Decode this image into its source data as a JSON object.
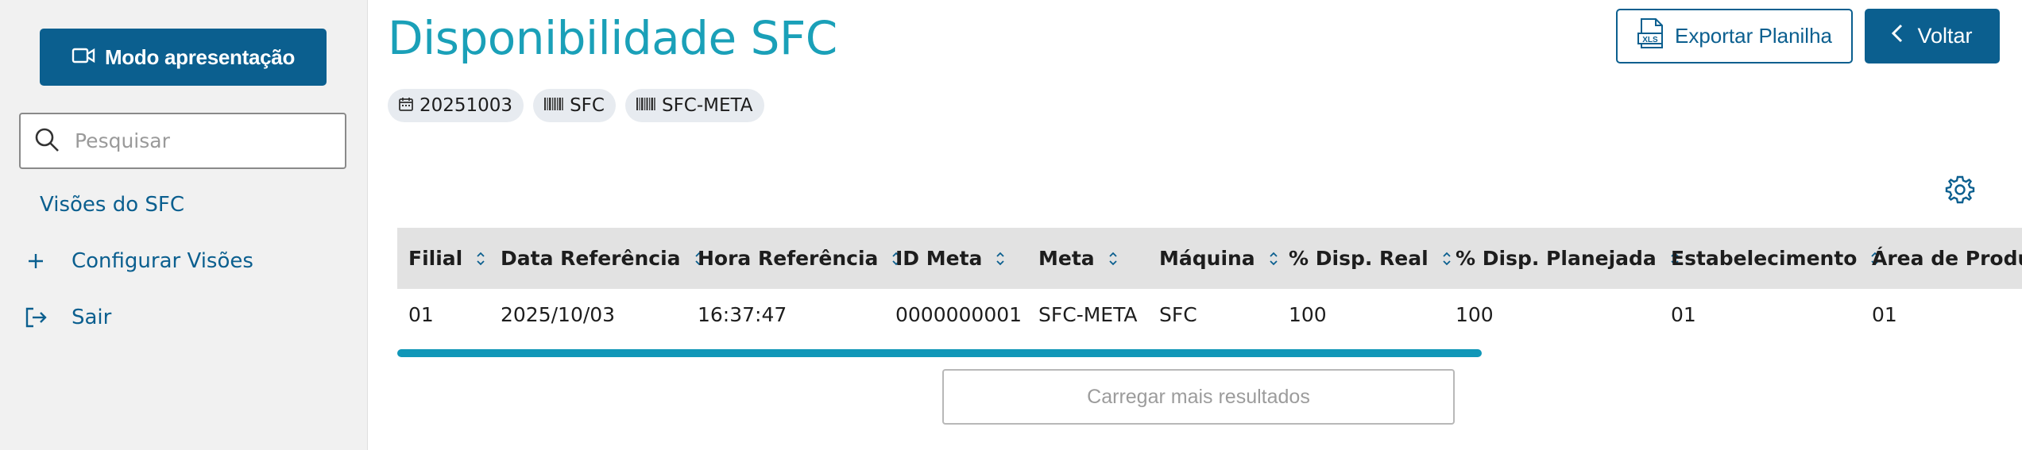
{
  "sidebar": {
    "presentation_button": "Modo apresentação",
    "search": {
      "placeholder": "Pesquisar",
      "value": ""
    },
    "views_link": "Visões do SFC",
    "configure_views": "Configurar Visões",
    "logout": "Sair"
  },
  "header": {
    "title": "Disponibilidade SFC",
    "export_button": "Exportar Planilha",
    "back_button": "Voltar"
  },
  "filters": {
    "date": "20251003",
    "machine": "SFC",
    "meta": "SFC-META"
  },
  "table": {
    "columns": [
      "Filial",
      "Data Referência",
      "Hora Referência",
      "ID Meta",
      "Meta",
      "Máquina",
      "% Disp. Real",
      "% Disp. Planejada",
      "Estabelecimento",
      "Área de Produção"
    ],
    "rows": [
      [
        "01",
        "2025/10/03",
        "16:37:47",
        "0000000001",
        "SFC-META",
        "SFC",
        "100",
        "100",
        "01",
        "01"
      ]
    ]
  },
  "load_more": "Carregar mais resultados",
  "colors": {
    "primary": "#0b5f8f",
    "title": "#1aa0b8",
    "scrollbar": "#1197b8",
    "sidebar_bg": "#f1f1f1",
    "header_bg": "#e2e2e2"
  }
}
